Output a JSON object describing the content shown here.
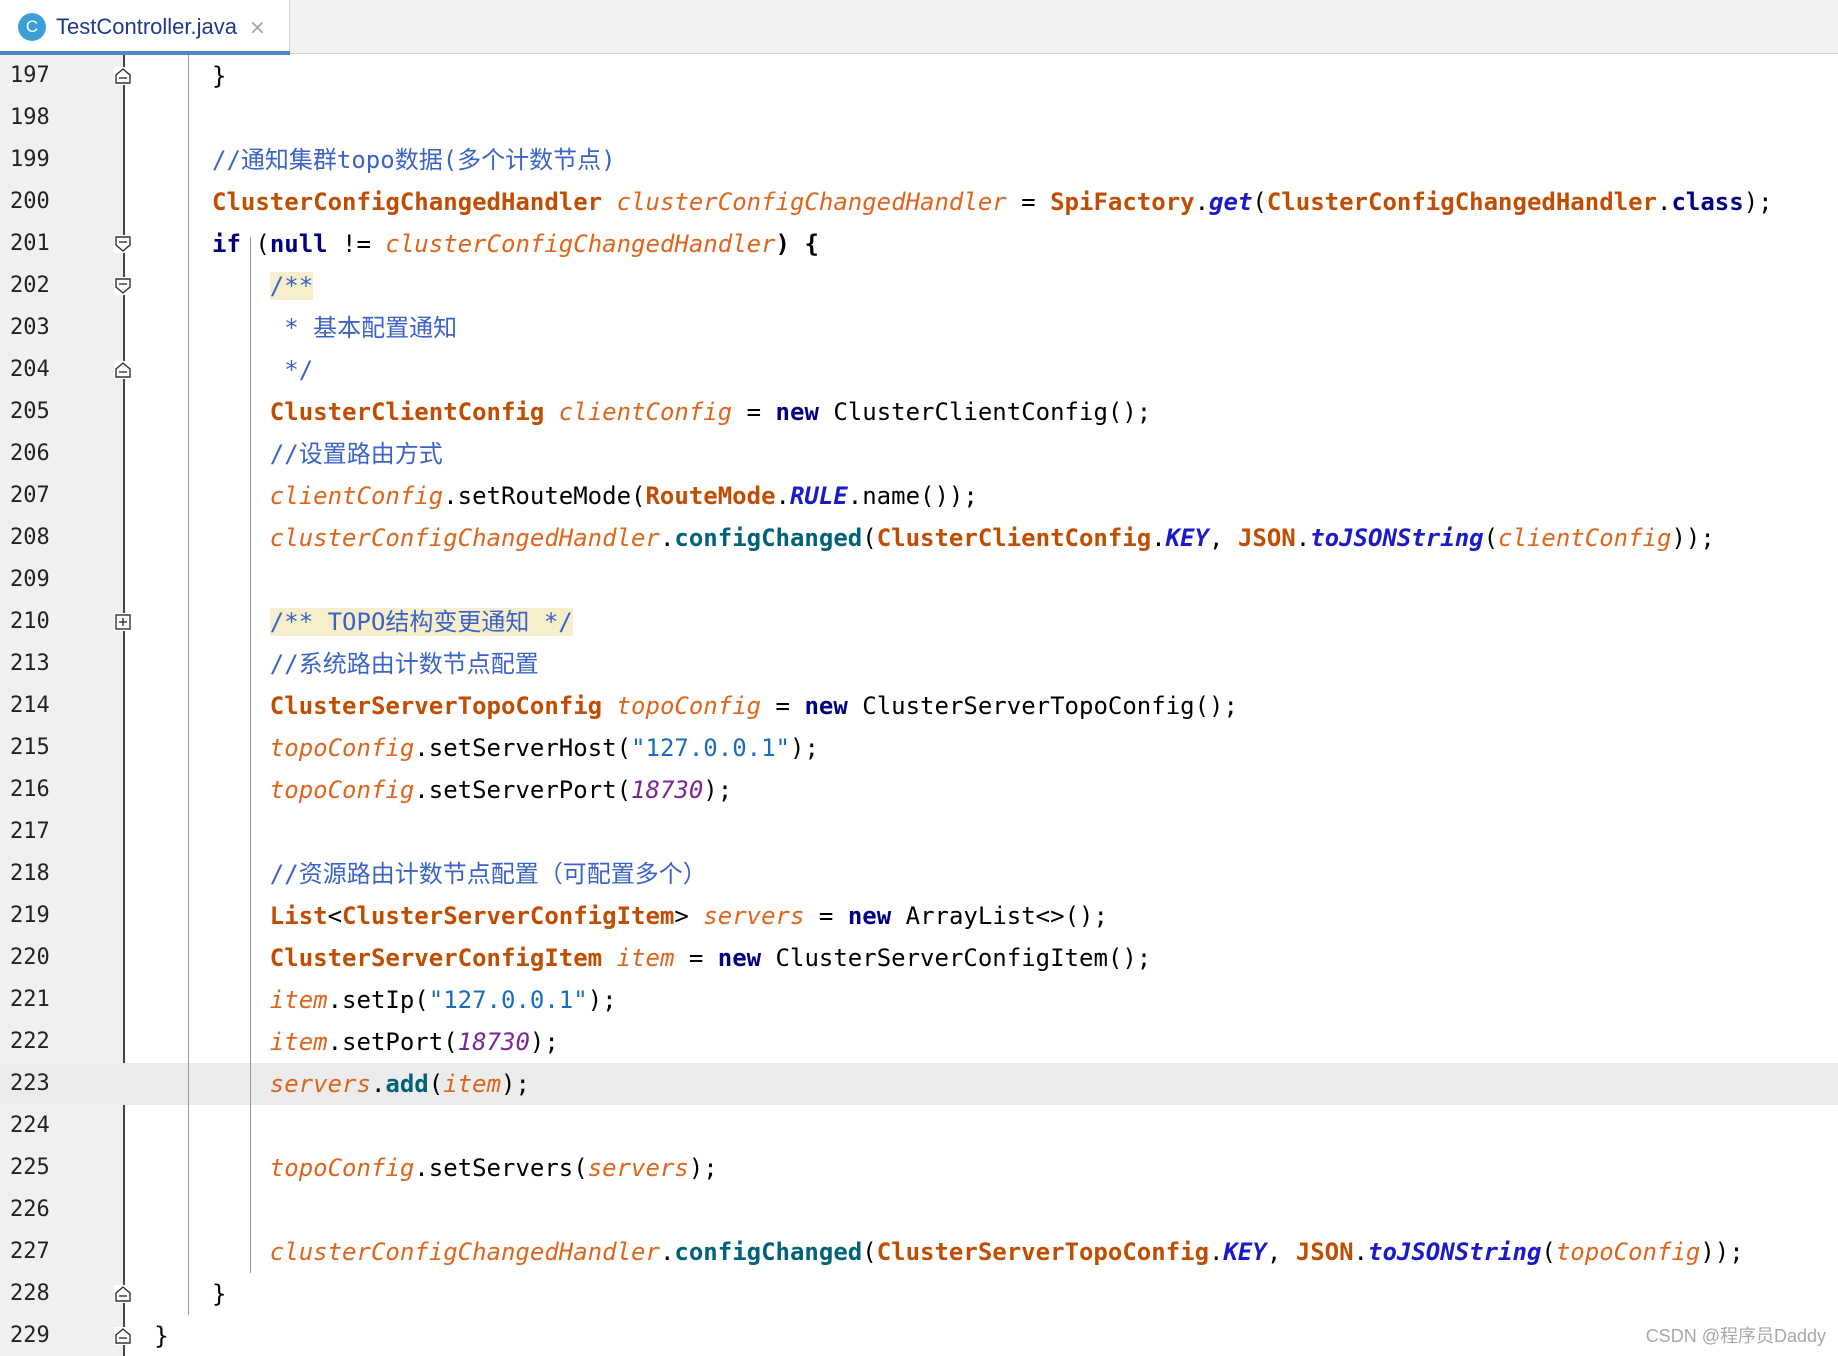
{
  "tab": {
    "icon_letter": "C",
    "label": "TestController.java",
    "close": "×"
  },
  "watermark": "CSDN @程序员Daddy",
  "current_line": "223",
  "lines": [
    {
      "num": "197",
      "fold": "end",
      "indent": 4,
      "tokens": [
        [
          "}",
          "pl"
        ]
      ]
    },
    {
      "num": "198",
      "fold": null,
      "indent": 0,
      "tokens": []
    },
    {
      "num": "199",
      "fold": null,
      "indent": 4,
      "tokens": [
        [
          "//通知集群topo数据(多个计数节点)",
          "cm"
        ]
      ]
    },
    {
      "num": "200",
      "fold": null,
      "indent": 4,
      "tokens": [
        [
          "ClusterConfigChangedHandler",
          "cls"
        ],
        [
          " ",
          "pl"
        ],
        [
          "clusterConfigChangedHandler",
          "ins"
        ],
        [
          " = ",
          "pl"
        ],
        [
          "SpiFactory",
          "cls"
        ],
        [
          ".",
          "pl"
        ],
        [
          "get",
          "mth"
        ],
        [
          "(",
          "pl"
        ],
        [
          "ClusterConfigChangedHandler",
          "cls"
        ],
        [
          ".",
          "pl"
        ],
        [
          "class",
          "kw"
        ],
        [
          ");",
          "pl"
        ]
      ]
    },
    {
      "num": "201",
      "fold": "start",
      "indent": 4,
      "tokens": [
        [
          "if",
          "kw"
        ],
        [
          " (",
          "pl"
        ],
        [
          "null",
          "kw"
        ],
        [
          " != ",
          "pl"
        ],
        [
          "clusterConfigChangedHandler",
          "ins"
        ],
        [
          ") {",
          "bp"
        ]
      ]
    },
    {
      "num": "202",
      "fold": "start",
      "indent": 8,
      "tokens": [
        [
          "/**",
          "cmh"
        ]
      ]
    },
    {
      "num": "203",
      "fold": null,
      "indent": 8,
      "tokens": [
        [
          " * 基本配置通知",
          "cm"
        ]
      ]
    },
    {
      "num": "204",
      "fold": "end",
      "indent": 8,
      "tokens": [
        [
          " */",
          "cm"
        ]
      ]
    },
    {
      "num": "205",
      "fold": null,
      "indent": 8,
      "tokens": [
        [
          "ClusterClientConfig",
          "cls"
        ],
        [
          " ",
          "pl"
        ],
        [
          "clientConfig",
          "ins"
        ],
        [
          " = ",
          "pl"
        ],
        [
          "new",
          "kw"
        ],
        [
          " ClusterClientConfig();",
          "pl"
        ]
      ]
    },
    {
      "num": "206",
      "fold": null,
      "indent": 8,
      "tokens": [
        [
          "//设置路由方式",
          "cm"
        ]
      ]
    },
    {
      "num": "207",
      "fold": null,
      "indent": 8,
      "tokens": [
        [
          "clientConfig",
          "ins"
        ],
        [
          ".setRouteMode(",
          "pl"
        ],
        [
          "RouteMode",
          "cls"
        ],
        [
          ".",
          "pl"
        ],
        [
          "RULE",
          "mth"
        ],
        [
          ".name());",
          "pl"
        ]
      ]
    },
    {
      "num": "208",
      "fold": null,
      "indent": 8,
      "tokens": [
        [
          "clusterConfigChangedHandler",
          "ins"
        ],
        [
          ".",
          "pl"
        ],
        [
          "configChanged",
          "mt"
        ],
        [
          "(",
          "pl"
        ],
        [
          "ClusterClientConfig",
          "cls"
        ],
        [
          ".",
          "pl"
        ],
        [
          "KEY",
          "mth"
        ],
        [
          ", ",
          "pl"
        ],
        [
          "JSON",
          "cls"
        ],
        [
          ".",
          "pl"
        ],
        [
          "toJSONString",
          "mth"
        ],
        [
          "(",
          "pl"
        ],
        [
          "clientConfig",
          "ins"
        ],
        [
          "));",
          "pl"
        ]
      ]
    },
    {
      "num": "209",
      "fold": null,
      "indent": 0,
      "tokens": []
    },
    {
      "num": "210",
      "fold": "collapsed",
      "indent": 8,
      "tokens": [
        [
          "/** TOPO结构变更通知 */",
          "cmh"
        ]
      ]
    },
    {
      "num": "213",
      "fold": null,
      "indent": 8,
      "tokens": [
        [
          "//系统路由计数节点配置",
          "cm"
        ]
      ]
    },
    {
      "num": "214",
      "fold": null,
      "indent": 8,
      "tokens": [
        [
          "ClusterServerTopoConfig",
          "cls"
        ],
        [
          " ",
          "pl"
        ],
        [
          "topoConfig",
          "ins"
        ],
        [
          " = ",
          "pl"
        ],
        [
          "new",
          "kw"
        ],
        [
          " ClusterServerTopoConfig();",
          "pl"
        ]
      ]
    },
    {
      "num": "215",
      "fold": null,
      "indent": 8,
      "tokens": [
        [
          "topoConfig",
          "ins"
        ],
        [
          ".setServerHost(",
          "pl"
        ],
        [
          "\"127.0.0.1\"",
          "st"
        ],
        [
          ");",
          "pl"
        ]
      ]
    },
    {
      "num": "216",
      "fold": null,
      "indent": 8,
      "tokens": [
        [
          "topoConfig",
          "ins"
        ],
        [
          ".setServerPort(",
          "pl"
        ],
        [
          "18730",
          "num"
        ],
        [
          ");",
          "pl"
        ]
      ]
    },
    {
      "num": "217",
      "fold": null,
      "indent": 0,
      "tokens": []
    },
    {
      "num": "218",
      "fold": null,
      "indent": 8,
      "tokens": [
        [
          "//资源路由计数节点配置（可配置多个）",
          "cm"
        ]
      ]
    },
    {
      "num": "219",
      "fold": null,
      "indent": 8,
      "tokens": [
        [
          "List",
          "cls"
        ],
        [
          "<",
          "pl"
        ],
        [
          "ClusterServerConfigItem",
          "cls"
        ],
        [
          "> ",
          "pl"
        ],
        [
          "servers",
          "ins"
        ],
        [
          " = ",
          "pl"
        ],
        [
          "new",
          "kw"
        ],
        [
          " ArrayList<>();",
          "pl"
        ]
      ]
    },
    {
      "num": "220",
      "fold": null,
      "indent": 8,
      "tokens": [
        [
          "ClusterServerConfigItem",
          "cls"
        ],
        [
          " ",
          "pl"
        ],
        [
          "item",
          "ins"
        ],
        [
          " = ",
          "pl"
        ],
        [
          "new",
          "kw"
        ],
        [
          " ClusterServerConfigItem();",
          "pl"
        ]
      ]
    },
    {
      "num": "221",
      "fold": null,
      "indent": 8,
      "tokens": [
        [
          "item",
          "ins"
        ],
        [
          ".setIp(",
          "pl"
        ],
        [
          "\"127.0.0.1\"",
          "st"
        ],
        [
          ");",
          "pl"
        ]
      ]
    },
    {
      "num": "222",
      "fold": null,
      "indent": 8,
      "tokens": [
        [
          "item",
          "ins"
        ],
        [
          ".setPort(",
          "pl"
        ],
        [
          "18730",
          "num"
        ],
        [
          ");",
          "pl"
        ]
      ]
    },
    {
      "num": "223",
      "fold": null,
      "indent": 8,
      "tokens": [
        [
          "servers",
          "ins"
        ],
        [
          ".",
          "pl"
        ],
        [
          "add",
          "mt"
        ],
        [
          "(",
          "pl"
        ],
        [
          "item",
          "ins"
        ],
        [
          ");",
          "pl"
        ]
      ]
    },
    {
      "num": "224",
      "fold": null,
      "indent": 0,
      "tokens": []
    },
    {
      "num": "225",
      "fold": null,
      "indent": 8,
      "tokens": [
        [
          "topoConfig",
          "ins"
        ],
        [
          ".setServers(",
          "pl"
        ],
        [
          "servers",
          "ins"
        ],
        [
          ");",
          "pl"
        ]
      ]
    },
    {
      "num": "226",
      "fold": null,
      "indent": 0,
      "tokens": []
    },
    {
      "num": "227",
      "fold": null,
      "indent": 8,
      "tokens": [
        [
          "clusterConfigChangedHandler",
          "ins"
        ],
        [
          ".",
          "pl"
        ],
        [
          "configChanged",
          "mt"
        ],
        [
          "(",
          "pl"
        ],
        [
          "ClusterServerTopoConfig",
          "cls"
        ],
        [
          ".",
          "pl"
        ],
        [
          "KEY",
          "mth"
        ],
        [
          ", ",
          "pl"
        ],
        [
          "JSON",
          "cls"
        ],
        [
          ".",
          "pl"
        ],
        [
          "toJSONString",
          "mth"
        ],
        [
          "(",
          "pl"
        ],
        [
          "topoConfig",
          "ins"
        ],
        [
          "));",
          "pl"
        ]
      ]
    },
    {
      "num": "228",
      "fold": "end",
      "indent": 4,
      "tokens": [
        [
          "}",
          "pl"
        ]
      ]
    },
    {
      "num": "229",
      "fold": "end",
      "indent": 0,
      "tokens": [
        [
          "}",
          "pl"
        ]
      ]
    }
  ]
}
